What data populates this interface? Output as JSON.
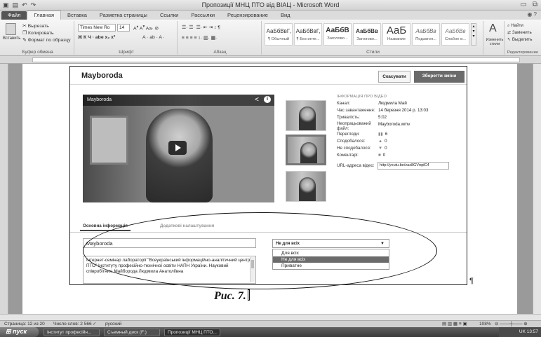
{
  "window": {
    "title": "Пропозиції МНЦ ПТО від ВІАЦ - Microsoft Word",
    "qat_icons": [
      "word-icon",
      "save-icon",
      "undo-icon",
      "redo-icon"
    ]
  },
  "ribbon_tabs": [
    "Файл",
    "Главная",
    "Вставка",
    "Разметка страницы",
    "Ссылки",
    "Рассылки",
    "Рецензирование",
    "Вид"
  ],
  "clipboard": {
    "paste": "Вставить",
    "cut": "Вырезать",
    "copy": "Копировать",
    "format": "Формат по образцу",
    "label": "Буфер обмена"
  },
  "font": {
    "name": "Times New Ro",
    "size": "14",
    "label": "Шрифт",
    "row2": "Ж К Ч · abe x₂ x²"
  },
  "paragraph": {
    "label": "Абзац"
  },
  "styles": {
    "label": "Стили",
    "items": [
      {
        "sample": "АаБбВвГ,",
        "name": "¶ Обычный"
      },
      {
        "sample": "АаБбВвГ,",
        "name": "¶ Без инте..."
      },
      {
        "sample": "АаБбВ",
        "name": "Заголово..."
      },
      {
        "sample": "АаБбВв",
        "name": "Заголово..."
      },
      {
        "sample": "АаБ",
        "name": "Название"
      },
      {
        "sample": "АаБбВв",
        "name": "Подзагол..."
      },
      {
        "sample": "АаБбВв",
        "name": "Слабое в..."
      }
    ],
    "change": "Изменить стили"
  },
  "editing": {
    "find": "Найти",
    "replace": "Заменить",
    "select": "Выделить",
    "label": "Редактирование"
  },
  "shot": {
    "title": "Mayboroda",
    "cancel": "Скасувати",
    "save": "Зберегти зміни",
    "player_title": "Mayboroda",
    "info_heading": "ІНФОРМАЦІЯ ПРО ВІДЕО",
    "info": [
      {
        "k": "Канал:",
        "v": "Людмила Май",
        "ic": ""
      },
      {
        "k": "Час завантаження:",
        "v": "14 березня 2014 р. 13:03",
        "ic": ""
      },
      {
        "k": "Тривалість:",
        "v": "5:02",
        "ic": ""
      },
      {
        "k": "Неопрацьований файл:",
        "v": "Mayboroda.wmv",
        "ic": ""
      },
      {
        "k": "Перегляди:",
        "v": "6",
        "ic": "▮▮"
      },
      {
        "k": "Сподобалося:",
        "v": "0",
        "ic": "👍"
      },
      {
        "k": "Не сподобалося:",
        "v": "0",
        "ic": "👎"
      },
      {
        "k": "Коментарі:",
        "v": "0",
        "ic": "▬"
      }
    ],
    "url_label": "URL-адреса відео:",
    "url_value": "http://youtu.be/zaz8GVrqdC4",
    "tab_basic": "Основна інформація",
    "tab_advanced": "Додаткові налаштування",
    "title_value": "Mayboroda",
    "description": "Інтернет-семінар лабораторії \"Всеукраїнський інформаційно-аналітичний центр ПТО\" Інституту професійно-технічної освіти НАПН України. Науковий співробітник: Майборода Людмила Анатоліївна",
    "privacy_selected": "Не для всіх",
    "privacy_options": [
      "Для всіх",
      "Не для всіх",
      "Приватне"
    ]
  },
  "caption": "Рис. 7.",
  "status": {
    "page": "Страница: 12 из 20",
    "words": "Число слов: 2 566",
    "lang": "русский",
    "zoom": "108%"
  },
  "taskbar": {
    "start": "пуск",
    "items": [
      "Інститут професійн...",
      "Съемный диск (F:)",
      "Пропозиції МНЦ ПТО..."
    ],
    "tray": "UK  13:57"
  }
}
